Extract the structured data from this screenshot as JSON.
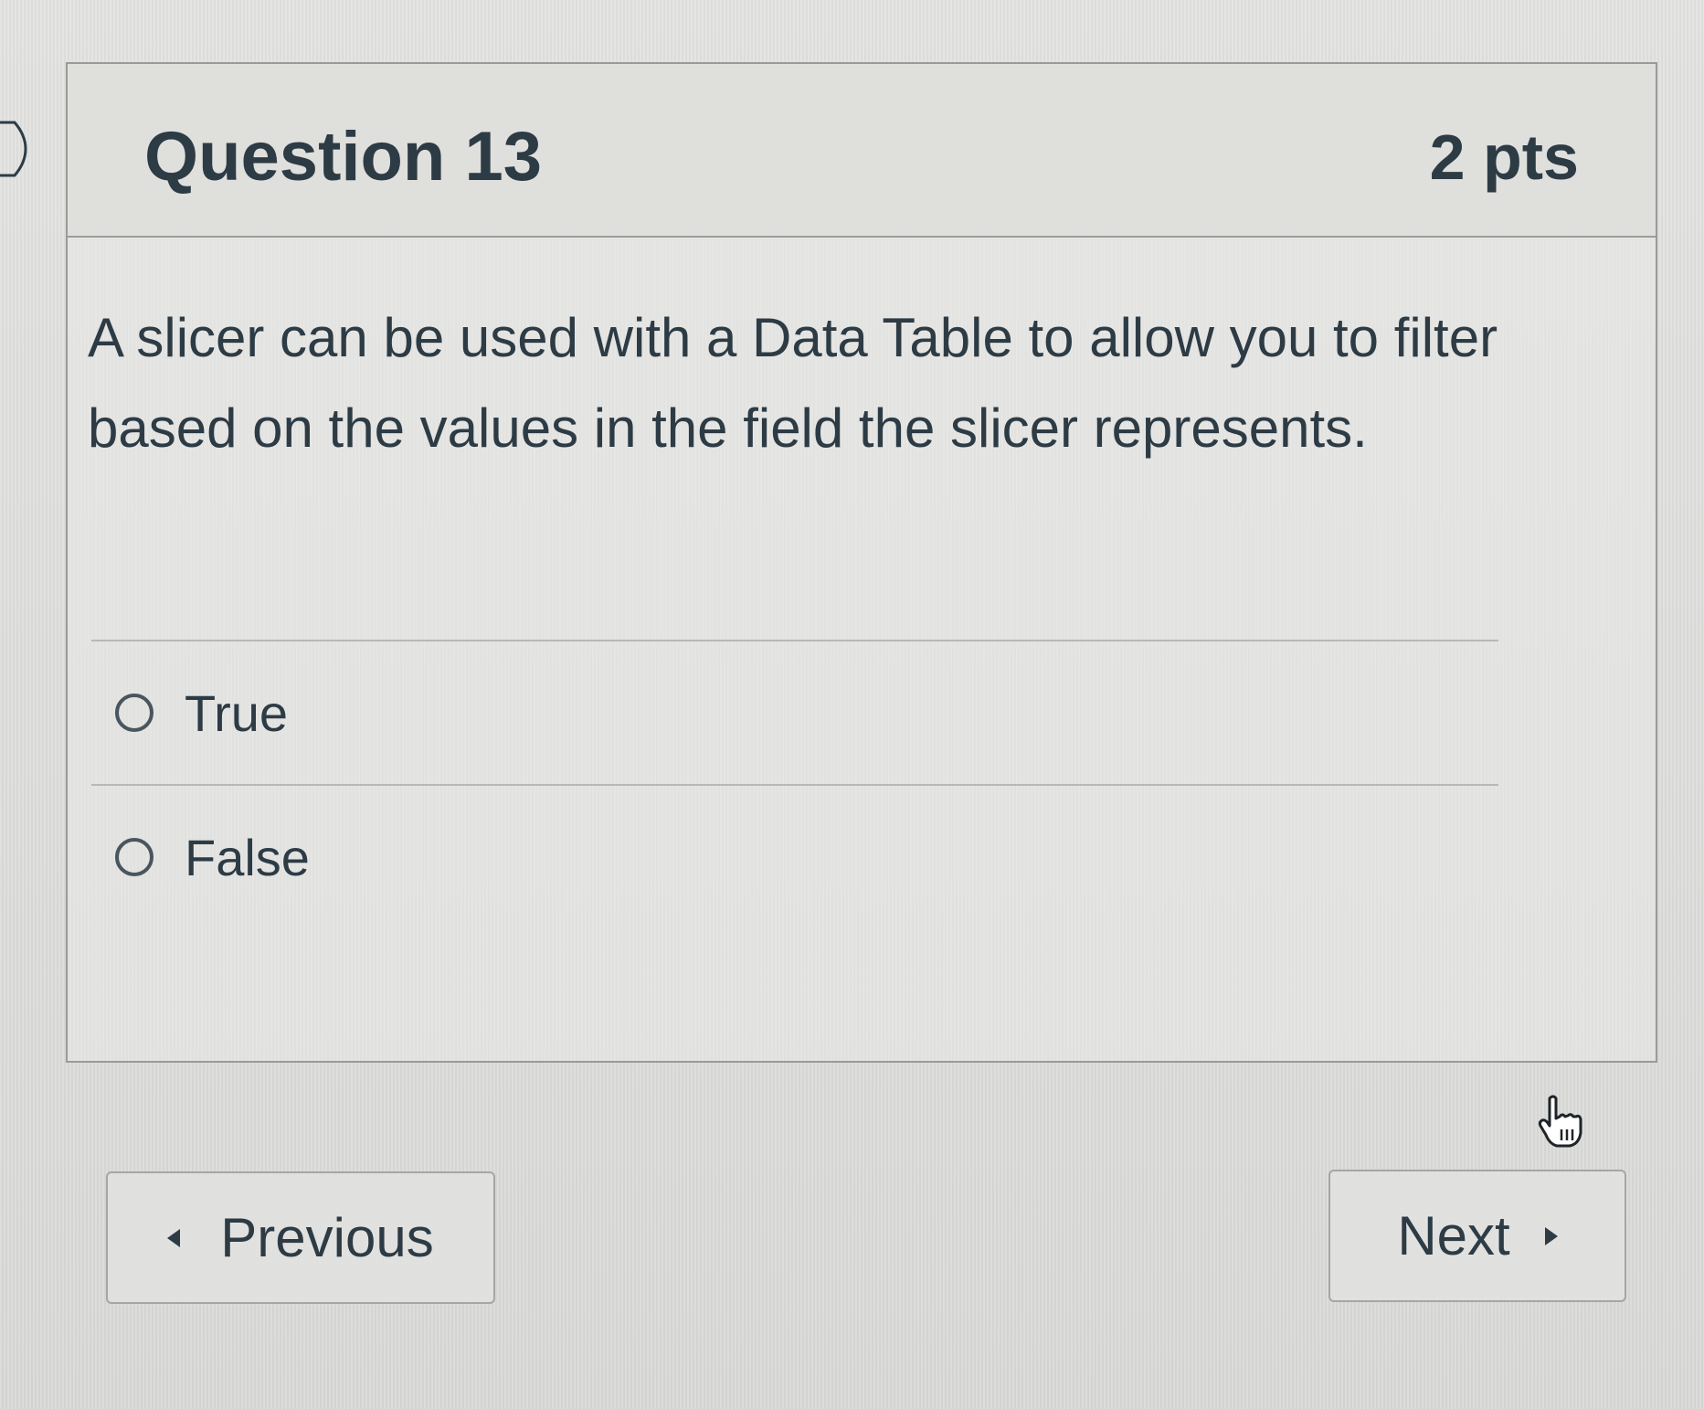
{
  "question": {
    "title": "Question 13",
    "points": "2 pts",
    "text": "A slicer can be used with a Data Table to allow you to filter based on the values in the field the slicer represents."
  },
  "answers": [
    {
      "label": "True",
      "selected": false
    },
    {
      "label": "False",
      "selected": false
    }
  ],
  "navigation": {
    "previous_label": "Previous",
    "next_label": "Next"
  },
  "icons": {
    "expand": "chevron-right-icon",
    "previous": "caret-left-icon",
    "next": "caret-right-icon",
    "cursor": "hand-pointer-icon"
  },
  "colors": {
    "text": "#2d3b45",
    "border": "#9a9a98",
    "background": "#dfdfdd"
  }
}
